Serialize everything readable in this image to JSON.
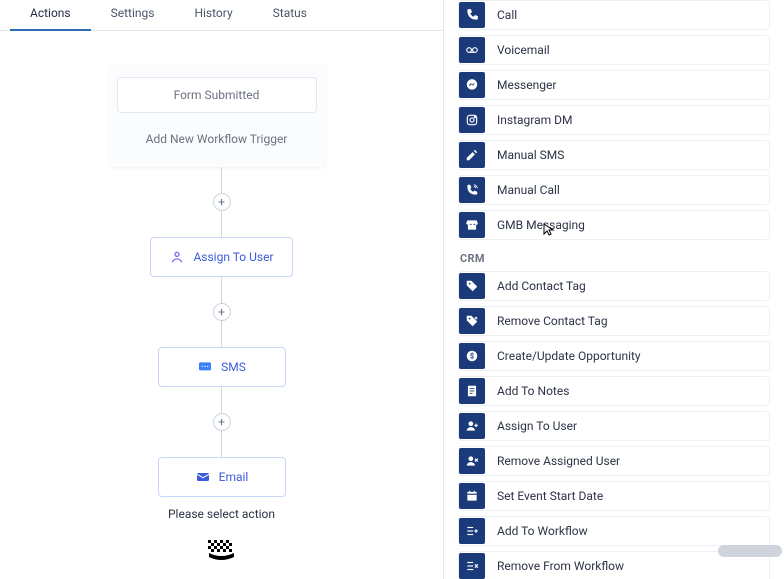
{
  "tabs": [
    {
      "label": "Actions",
      "active": true
    },
    {
      "label": "Settings",
      "active": false
    },
    {
      "label": "History",
      "active": false
    },
    {
      "label": "Status",
      "active": false
    }
  ],
  "trigger": {
    "card_label": "Form Submitted",
    "add_label": "Add New Workflow Trigger"
  },
  "workflow_nodes": {
    "assign": {
      "label": "Assign To User"
    },
    "sms": {
      "label": "SMS"
    },
    "email": {
      "label": "Email"
    }
  },
  "placeholder_text": "Please select action",
  "right_panel": {
    "top_group": [
      {
        "key": "call",
        "label": "Call",
        "icon": "phone"
      },
      {
        "key": "voicemail",
        "label": "Voicemail",
        "icon": "voicemail"
      },
      {
        "key": "messenger",
        "label": "Messenger",
        "icon": "messenger"
      },
      {
        "key": "instagram",
        "label": "Instagram DM",
        "icon": "instagram"
      },
      {
        "key": "manual_sms",
        "label": "Manual SMS",
        "icon": "pencil"
      },
      {
        "key": "manual_call",
        "label": "Manual Call",
        "icon": "phone-ring"
      },
      {
        "key": "gmb",
        "label": "GMB Messaging",
        "icon": "storefront"
      }
    ],
    "crm_heading": "CRM",
    "crm_group": [
      {
        "key": "add_tag",
        "label": "Add Contact Tag",
        "icon": "tag"
      },
      {
        "key": "remove_tag",
        "label": "Remove Contact Tag",
        "icon": "tag-x"
      },
      {
        "key": "opportunity",
        "label": "Create/Update Opportunity",
        "icon": "dollar"
      },
      {
        "key": "notes",
        "label": "Add To Notes",
        "icon": "note"
      },
      {
        "key": "assign_user",
        "label": "Assign To User",
        "icon": "user-plus"
      },
      {
        "key": "remove_user",
        "label": "Remove Assigned User",
        "icon": "user-x"
      },
      {
        "key": "event_date",
        "label": "Set Event Start Date",
        "icon": "calendar"
      },
      {
        "key": "add_workflow",
        "label": "Add To Workflow",
        "icon": "list-plus"
      },
      {
        "key": "remove_workflow",
        "label": "Remove From Workflow",
        "icon": "list-x"
      }
    ]
  }
}
